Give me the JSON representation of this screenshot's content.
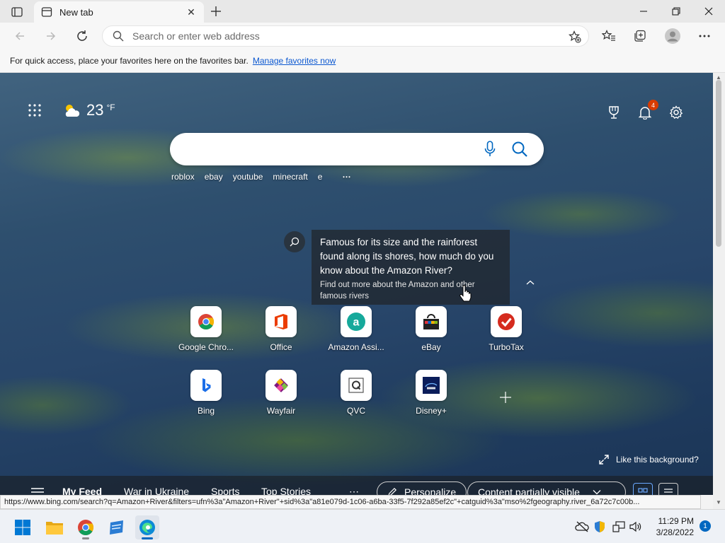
{
  "browser": {
    "tab": {
      "title": "New tab"
    },
    "address": {
      "placeholder": "Search or enter web address"
    },
    "favorites_bar": {
      "message": "For quick access, place your favorites here on the favorites bar.",
      "link": "Manage favorites now"
    }
  },
  "newtab": {
    "weather": {
      "temperature": "23",
      "unit": "°F",
      "icon": "partly-cloudy-icon"
    },
    "notifications_count": "4",
    "trending": [
      "roblox",
      "ebay",
      "youtube",
      "minecraft",
      "e"
    ],
    "trending_more": "⋯",
    "info_card": {
      "headline": "Famous for its size and the rainforest found along its shores, how much do you know about the Amazon River?",
      "subtext": "Find out more about the Amazon and other famous rivers"
    },
    "quick_links": [
      {
        "label": "Google Chro...",
        "icon": "chrome-icon"
      },
      {
        "label": "Office",
        "icon": "office-icon"
      },
      {
        "label": "Amazon Assi...",
        "icon": "amazon-assistant-icon"
      },
      {
        "label": "eBay",
        "icon": "ebay-icon"
      },
      {
        "label": "TurboTax",
        "icon": "turbotax-icon"
      },
      {
        "label": "Bing",
        "icon": "bing-icon"
      },
      {
        "label": "Wayfair",
        "icon": "wayfair-icon"
      },
      {
        "label": "QVC",
        "icon": "qvc-icon"
      },
      {
        "label": "Disney+",
        "icon": "disney-plus-icon"
      }
    ],
    "like_background": "Like this background?",
    "feed": {
      "items": [
        "My Feed",
        "War in Ukraine",
        "Sports",
        "Top Stories"
      ],
      "more": "⋯",
      "personalize": "Personalize",
      "content_visibility": "Content partially visible"
    }
  },
  "status_url": "https://www.bing.com/search?q=Amazon+River&filters=ufn%3a\"Amazon+River\"+sid%3a\"a81e079d-1c06-a6ba-33f5-7f292a85ef2c\"+catguid%3a\"mso%2fgeography.river_6a72c7c00b...",
  "taskbar": {
    "time": "11:29 PM",
    "date": "3/28/2022",
    "notification_count": "1"
  },
  "colors": {
    "accent": "#0067c0",
    "link": "#0b57d0",
    "badge": "#d83b01"
  }
}
